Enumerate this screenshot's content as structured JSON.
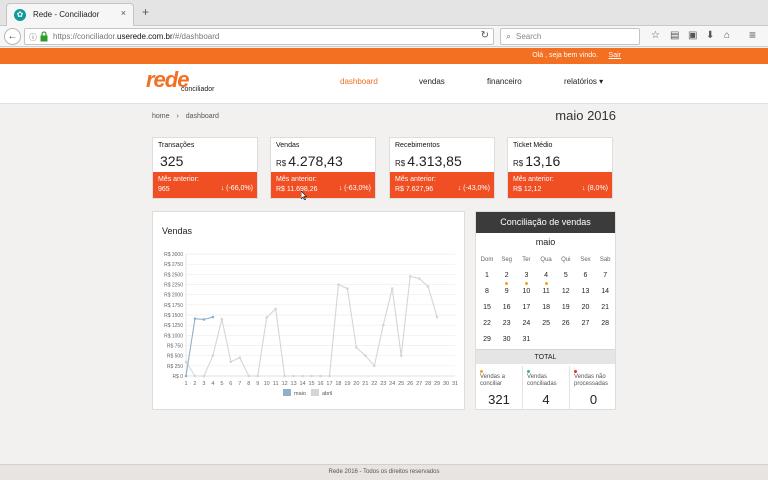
{
  "browser": {
    "tab_title": "Rede - Conciliador",
    "tab_close": "×",
    "new_tab": "+",
    "back": "←",
    "url_prefix": "https://conciliador.",
    "url_domain": "userede.com.br",
    "url_suffix": "/#/dashboard",
    "reload": "↻",
    "search_placeholder": "Search",
    "search_glass": "⌕",
    "icons": {
      "star": "☆",
      "reader": "▤",
      "lock2": "▣",
      "download": "⬇",
      "home": "⌂",
      "menu": "≡"
    }
  },
  "topbar": {
    "greeting": "Olá , seja bem vindo.",
    "logout": "Sair"
  },
  "header": {
    "logo": "rede",
    "logo_sub": "conciliador",
    "nav": {
      "dashboard": "dashboard",
      "vendas": "vendas",
      "financeiro": "financeiro",
      "relatorios": "relatórios ▾"
    },
    "active_color": "#f36f21"
  },
  "breadcrumb": {
    "home": "home",
    "sep": "›",
    "current": "dashboard"
  },
  "period": "maio 2016",
  "kpis": [
    {
      "title": "Transações",
      "currency": "",
      "value": "325",
      "label": "Mês anterior:",
      "previous": "965",
      "variation": "↓ (-66,0%)"
    },
    {
      "title": "Vendas",
      "currency": "R$",
      "value": "4.278,43",
      "label": "Mês anterior:",
      "previous": "R$ 11.698,26",
      "variation": "↓ (-63,0%)"
    },
    {
      "title": "Recebimentos",
      "currency": "R$",
      "value": "4.313,85",
      "label": "Mês anterior:",
      "previous": "R$ 7.627,96",
      "variation": "↓ (-43,0%)"
    },
    {
      "title": "Ticket Médio",
      "currency": "R$",
      "value": "13,16",
      "label": "Mês anterior:",
      "previous": "R$ 12,12",
      "variation": "↓ (8,0%)"
    }
  ],
  "chart_data": {
    "type": "line",
    "title": "Vendas",
    "x": [
      1,
      2,
      3,
      4,
      5,
      6,
      7,
      8,
      9,
      10,
      11,
      12,
      13,
      14,
      15,
      16,
      17,
      18,
      19,
      20,
      21,
      22,
      23,
      24,
      25,
      26,
      27,
      28,
      29,
      30,
      31
    ],
    "y_ticks": [
      "R$ 0",
      "R$ 250",
      "R$ 500",
      "R$ 750",
      "R$ 1000",
      "R$ 1250",
      "R$ 1500",
      "R$ 1750",
      "R$ 2000",
      "R$ 2250",
      "R$ 2500",
      "R$ 2750",
      "R$ 3000"
    ],
    "ylim": [
      0,
      3000
    ],
    "series": [
      {
        "name": "maio",
        "color": "#8fb1cc",
        "values": [
          0,
          1410,
          1390,
          1450
        ]
      },
      {
        "name": "abril",
        "color": "#d5d5d5",
        "values": [
          350,
          0,
          0,
          500,
          1400,
          350,
          450,
          0,
          0,
          1440,
          1650,
          0,
          0,
          0,
          0,
          0,
          0,
          2250,
          2150,
          700,
          500,
          250,
          1250,
          2150,
          500,
          2450,
          2400,
          2200,
          1450
        ]
      }
    ],
    "legend": "bottom"
  },
  "conciliation": {
    "title": "Conciliação de vendas",
    "month": "maio",
    "weekdays": [
      "Dom",
      "Seg",
      "Ter",
      "Qua",
      "Qui",
      "Sex",
      "Sab"
    ],
    "weeks": [
      [
        "1",
        "2",
        "3",
        "4",
        "5",
        "6",
        "7"
      ],
      [
        "8",
        "9",
        "10",
        "11",
        "12",
        "13",
        "14"
      ],
      [
        "15",
        "16",
        "17",
        "18",
        "19",
        "20",
        "21"
      ],
      [
        "22",
        "23",
        "24",
        "25",
        "26",
        "27",
        "28"
      ],
      [
        "29",
        "30",
        "31",
        "",
        "",
        "",
        ""
      ]
    ],
    "dot_days": [
      "2",
      "3",
      "4"
    ],
    "total_label": "TOTAL",
    "stats": [
      {
        "label": "Vendas a conciliar",
        "value": "321",
        "color": "#f5a21d"
      },
      {
        "label": "Vendas conciliadas",
        "value": "4",
        "color": "#2fb3a0"
      },
      {
        "label": "Vendas não processadas",
        "value": "0",
        "color": "#e0322a"
      }
    ]
  },
  "footer": "Rede 2016 - Todos os direitos reservados"
}
